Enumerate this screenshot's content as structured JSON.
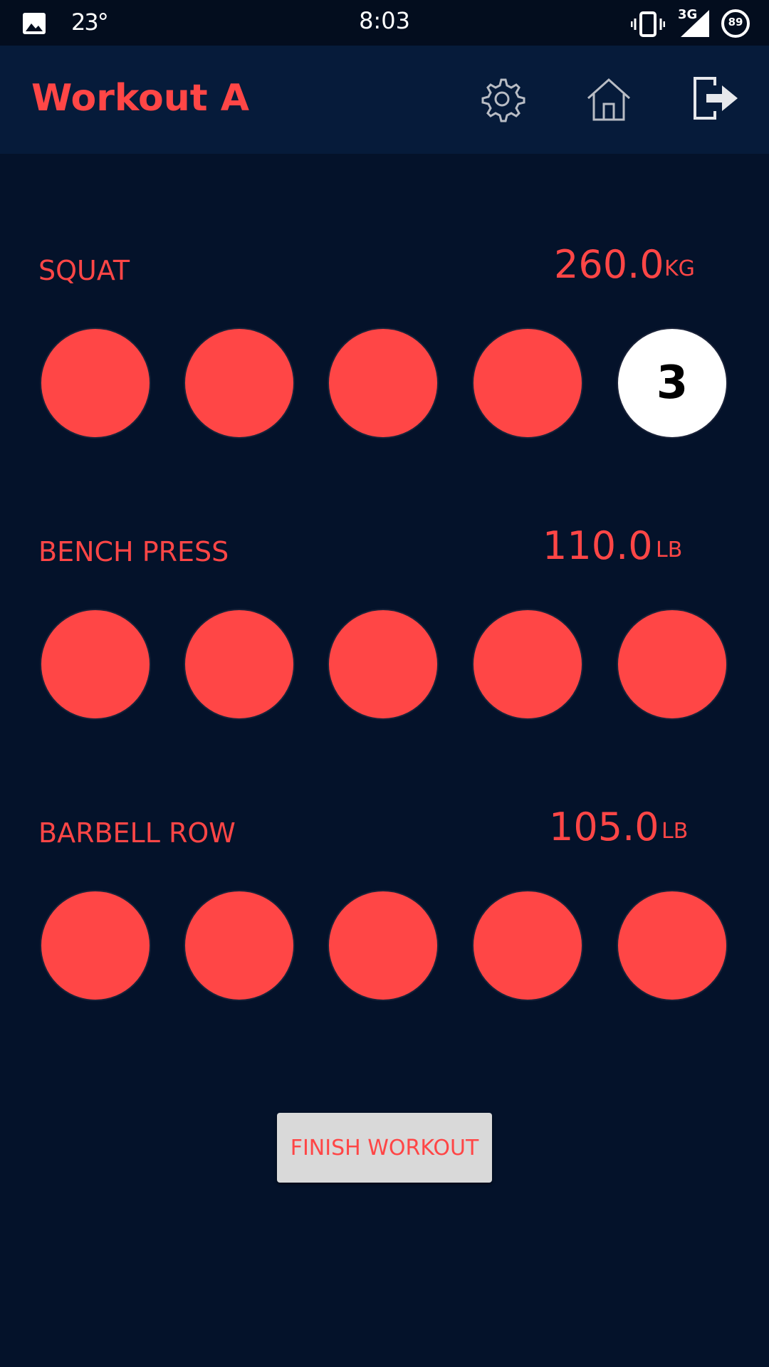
{
  "status_bar": {
    "temperature": "23°",
    "time": "8:03",
    "network": "3G",
    "battery": "89"
  },
  "app_bar": {
    "title": "Workout A",
    "actions": [
      {
        "name": "settings",
        "icon": "gear-icon"
      },
      {
        "name": "home",
        "icon": "home-icon"
      },
      {
        "name": "logout",
        "icon": "logout-icon"
      }
    ]
  },
  "exercises": [
    {
      "name": "SQUAT",
      "weight": "260.0",
      "unit": "KG",
      "sets": [
        {
          "reps": "",
          "state": "pending"
        },
        {
          "reps": "",
          "state": "pending"
        },
        {
          "reps": "",
          "state": "pending"
        },
        {
          "reps": "",
          "state": "pending"
        },
        {
          "reps": "3",
          "state": "done"
        }
      ]
    },
    {
      "name": "BENCH PRESS",
      "weight": "110.0",
      "unit": "LB",
      "sets": [
        {
          "reps": "",
          "state": "pending"
        },
        {
          "reps": "",
          "state": "pending"
        },
        {
          "reps": "",
          "state": "pending"
        },
        {
          "reps": "",
          "state": "pending"
        },
        {
          "reps": "",
          "state": "pending"
        }
      ]
    },
    {
      "name": "BARBELL ROW",
      "weight": "105.0",
      "unit": "LB",
      "sets": [
        {
          "reps": "",
          "state": "pending"
        },
        {
          "reps": "",
          "state": "pending"
        },
        {
          "reps": "",
          "state": "pending"
        },
        {
          "reps": "",
          "state": "pending"
        },
        {
          "reps": "",
          "state": "pending"
        }
      ]
    }
  ],
  "finish_button": {
    "label": "FINISH WORKOUT"
  },
  "colors": {
    "background": "#04122a",
    "app_bar": "#061b3a",
    "accent": "#ff4646",
    "set_done": "#ffffff",
    "button_bg": "#d9d9d9"
  }
}
